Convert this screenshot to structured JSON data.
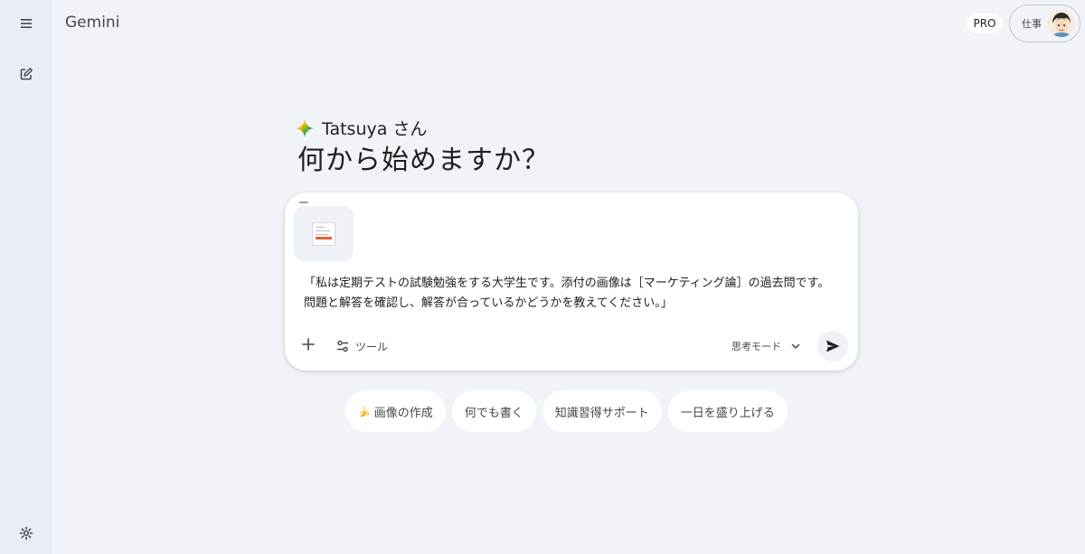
{
  "app": {
    "title": "Gemini"
  },
  "header": {
    "plan_badge": "PRO",
    "account_label": "仕事"
  },
  "sidebar": {
    "menu_icon": "menu-icon",
    "new_chat_icon": "edit-icon",
    "settings_icon": "gear-icon"
  },
  "greeting": {
    "name": "Tatsuya さん",
    "headline": "何から始めますか？"
  },
  "composer": {
    "prompt": "「私は定期テストの試験勉強をする大学生です。添付の画像は［マーケティング論］の過去問です。問題と解答を確認し、解答が合っているかどうかを教えてください。」",
    "tools_label": "ツール",
    "mode_label": "思考モード"
  },
  "chips": [
    {
      "emoji": "🍌",
      "label": "画像の作成"
    },
    {
      "label": "何でも書く"
    },
    {
      "label": "知識習得サポート"
    },
    {
      "label": "一日を盛り上げる"
    }
  ],
  "colors": {
    "background": "#f0f4f9",
    "sidebar": "#e9eef6",
    "spark_blue": "#4285f4",
    "spark_red": "#ea4335",
    "spark_yellow": "#fbbc04",
    "spark_green": "#34a853"
  }
}
